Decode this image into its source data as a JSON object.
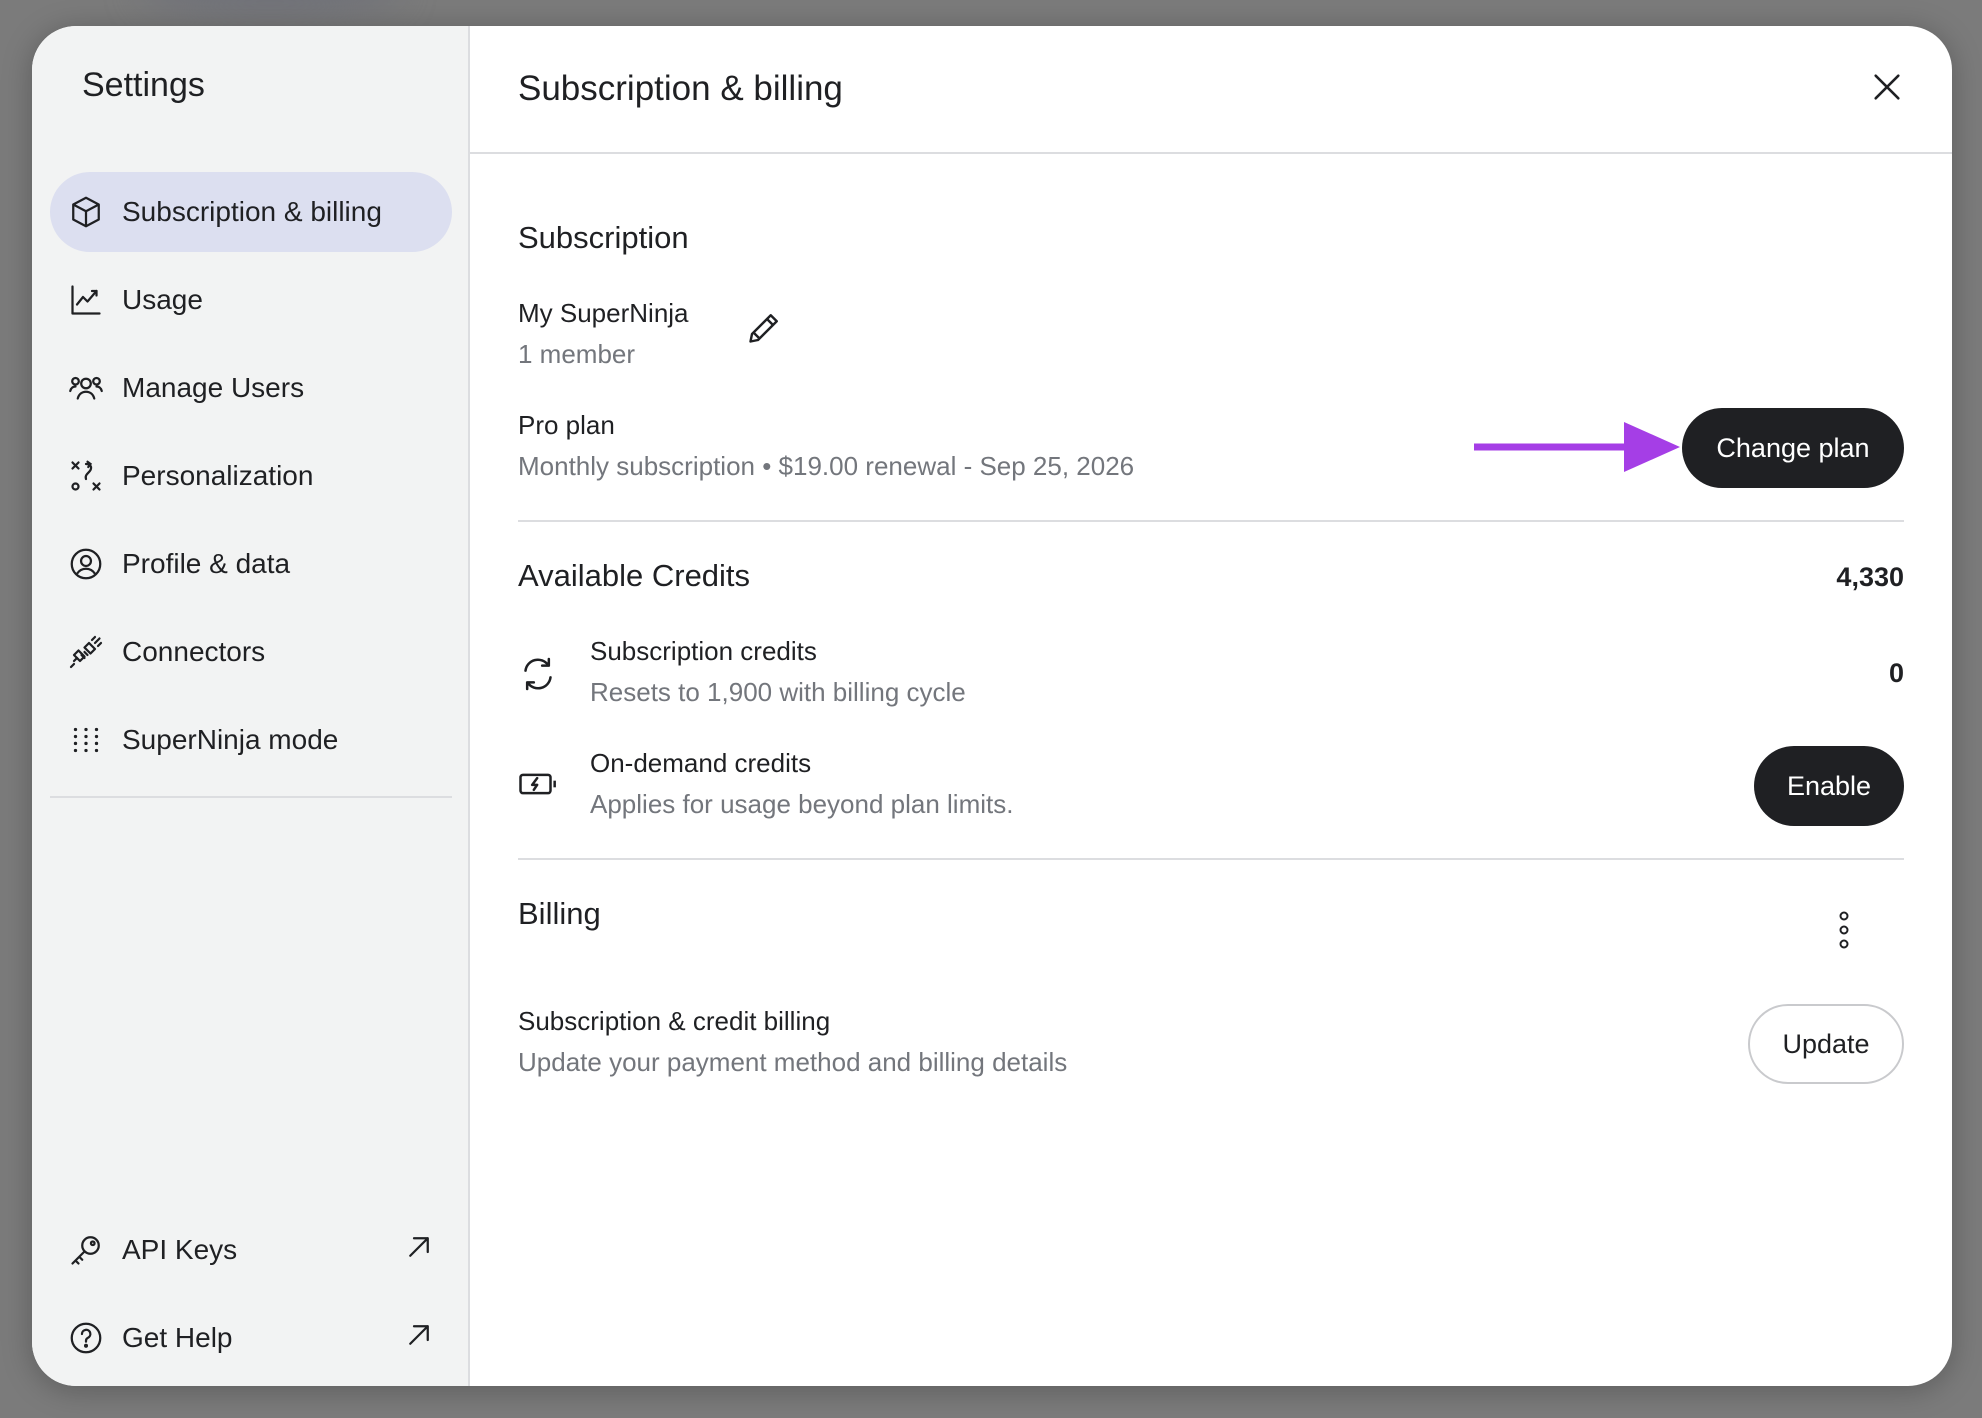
{
  "sidebar": {
    "title": "Settings",
    "items": [
      {
        "label": "Subscription & billing",
        "icon": "cube-icon",
        "active": true
      },
      {
        "label": "Usage",
        "icon": "chart-line-icon"
      },
      {
        "label": "Manage Users",
        "icon": "users-icon"
      },
      {
        "label": "Personalization",
        "icon": "personalization-icon"
      },
      {
        "label": "Profile & data",
        "icon": "user-circle-icon"
      },
      {
        "label": "Connectors",
        "icon": "plug-icon"
      },
      {
        "label": "SuperNinja mode",
        "icon": "dots-grid-icon"
      }
    ],
    "footer": [
      {
        "label": "API Keys",
        "icon": "key-icon",
        "ext_icon": "arrow-up-right-icon"
      },
      {
        "label": "Get Help",
        "icon": "help-circle-icon",
        "ext_icon": "arrow-up-right-icon"
      }
    ]
  },
  "main": {
    "title": "Subscription & billing",
    "subscription": {
      "heading": "Subscription",
      "team_name": "My SuperNinja",
      "members": "1 member",
      "plan_name": "Pro plan",
      "plan_details": "Monthly subscription • $19.00 renewal - Sep 25, 2026",
      "change_plan_label": "Change plan"
    },
    "credits": {
      "heading": "Available Credits",
      "total": "4,330",
      "subscription_credits_label": "Subscription credits",
      "subscription_credits_desc": "Resets to 1,900 with billing cycle",
      "subscription_credits_value": "0",
      "on_demand_label": "On-demand credits",
      "on_demand_desc": "Applies for usage beyond plan limits.",
      "enable_label": "Enable"
    },
    "billing": {
      "heading": "Billing",
      "item_label": "Subscription & credit billing",
      "item_desc": "Update your payment method and billing details",
      "update_label": "Update"
    }
  },
  "colors": {
    "accent_arrow": "#a53ee6",
    "active_nav_bg": "#dcdff0",
    "dark_button": "#1f2023"
  }
}
